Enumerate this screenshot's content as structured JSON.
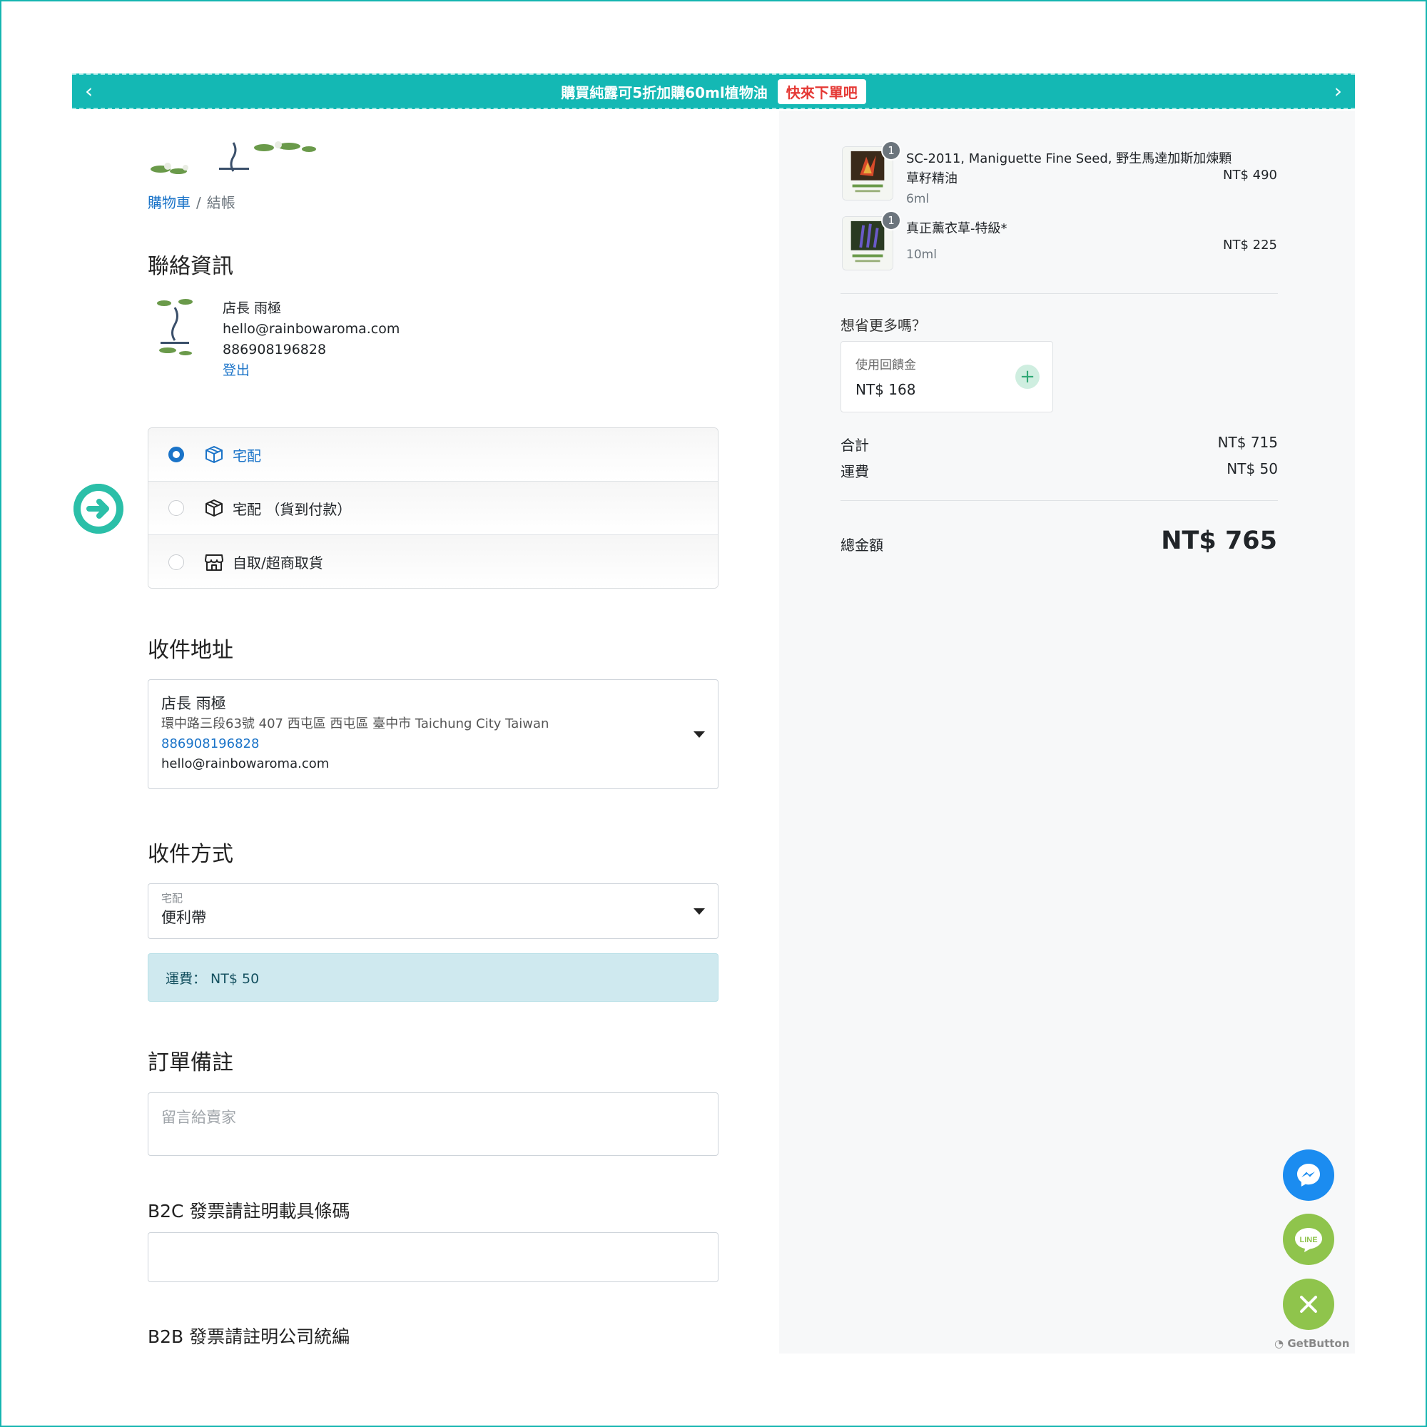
{
  "announcement": {
    "text": "購買純露可5折加購60ml植物油",
    "cta": "快來下單吧"
  },
  "breadcrumb": {
    "cart": "購物車",
    "separator": "/",
    "current": "結帳"
  },
  "contact": {
    "heading": "聯絡資訊",
    "name": "店長 雨極",
    "email": "hello@rainbowaroma.com",
    "phone": "886908196828",
    "logout": "登出"
  },
  "delivery_options": [
    {
      "label": "宅配",
      "selected": true,
      "icon": "box-icon"
    },
    {
      "label": "宅配 （貨到付款）",
      "selected": false,
      "icon": "box-icon"
    },
    {
      "label": "自取/超商取貨",
      "selected": false,
      "icon": "store-icon"
    }
  ],
  "address": {
    "heading": "收件地址",
    "name": "店長 雨極",
    "line": "環中路三段63號 407 西屯區 西屯區 臺中市 Taichung City Taiwan",
    "phone": "886908196828",
    "email": "hello@rainbowaroma.com"
  },
  "shipping_method": {
    "heading": "收件方式",
    "group": "宅配",
    "value": "便利帶",
    "fee_text": "運費： NT$ 50"
  },
  "order_note": {
    "heading": "訂單備註",
    "placeholder": "留言給賣家"
  },
  "invoice": {
    "b2c_label": "B2C 發票請註明載具條碼",
    "b2b_label": "B2B 發票請註明公司統編"
  },
  "cart_items": [
    {
      "qty": "1",
      "title": "SC-2011, Maniguette Fine Seed, 野生馬達加斯加煉顆草籽精油",
      "variant": "6ml",
      "price": "NT$ 490"
    },
    {
      "qty": "1",
      "title": "真正薰衣草-特級*",
      "variant": "10ml",
      "price": "NT$ 225"
    }
  ],
  "savings": {
    "title": "想省更多嗎？",
    "credit_label": "使用回饋金",
    "credit_amount": "NT$ 168"
  },
  "totals": {
    "subtotal_label": "合計",
    "subtotal": "NT$ 715",
    "shipping_label": "運費",
    "shipping": "NT$ 50",
    "total_label": "總金額",
    "total": "NT$ 765"
  },
  "widgets": {
    "line_label": "LINE",
    "getbutton": "GetButton"
  },
  "colors": {
    "brand": "#14b8b4",
    "link": "#1a73c8",
    "messenger": "#1b8cf0",
    "line": "#8fc44c"
  }
}
